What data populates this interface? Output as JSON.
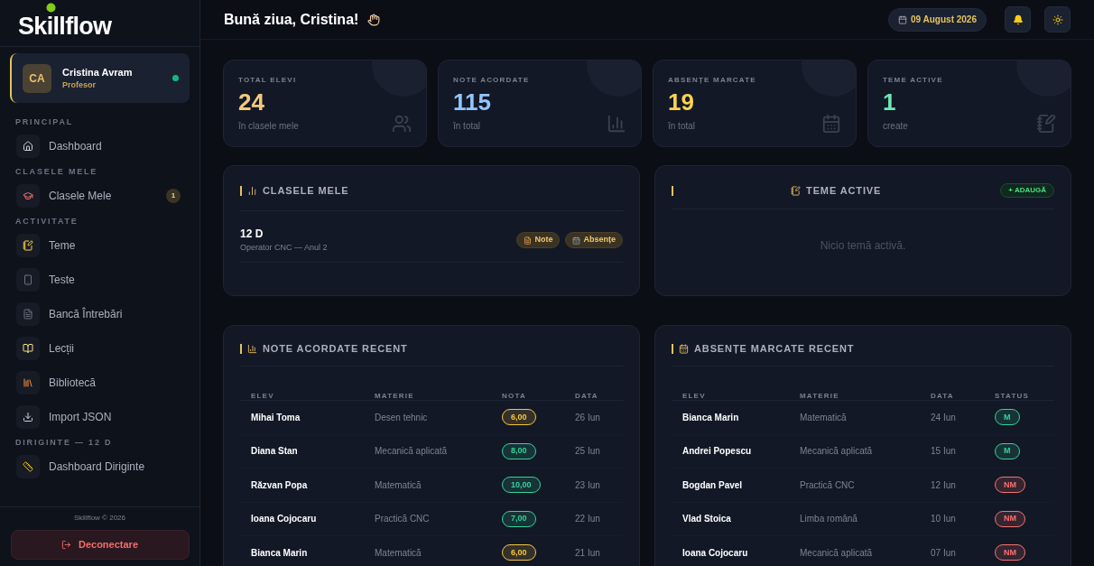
{
  "sidebar": {
    "logo": "Skillflow",
    "user": {
      "initials": "CA",
      "name": "Cristina Avram",
      "role": "Profesor",
      "online": true
    },
    "sections": [
      {
        "title": "PRINCIPAL",
        "items": [
          {
            "label": "Dashboard"
          }
        ]
      },
      {
        "title": "CLASELE MELE",
        "items": [
          {
            "label": "Clasele Mele",
            "badge": "1"
          }
        ]
      },
      {
        "title": "ACTIVITATE",
        "items": [
          {
            "label": "Teme"
          },
          {
            "label": "Teste"
          },
          {
            "label": "Bancă Întrebări"
          },
          {
            "label": "Lecții"
          },
          {
            "label": "Bibliotecă"
          },
          {
            "label": "Import JSON"
          }
        ]
      },
      {
        "title": "DIRIGINTE — 12 D",
        "items": [
          {
            "label": "Dashboard Diriginte"
          }
        ]
      }
    ],
    "footer": "Skillflow © 2026",
    "logout": "Deconectare"
  },
  "header": {
    "greeting": "Bună ziua, Cristina!",
    "date": "09 August 2026"
  },
  "stats": [
    {
      "label": "TOTAL ELEVI",
      "value": "24",
      "sub": "în clasele mele",
      "color": "#f5c97a"
    },
    {
      "label": "NOTE ACORDATE",
      "value": "115",
      "sub": "în total",
      "color": "#93c5fd"
    },
    {
      "label": "ABSENȚE MARCATE",
      "value": "19",
      "sub": "în total",
      "color": "#fcd34d"
    },
    {
      "label": "TEME ACTIVE",
      "value": "1",
      "sub": "create",
      "color": "#6ee7b7"
    }
  ],
  "classes_panel": {
    "title": "CLASELE MELE",
    "classes": [
      {
        "name": "12 D",
        "detail": "Operator CNC — Anul 2",
        "actions": [
          "Note",
          "Absențe"
        ]
      }
    ]
  },
  "homework_panel": {
    "title": "TEME ACTIVE",
    "add": "+ ADAUGĂ",
    "empty": "Nicio temă activă."
  },
  "grades_panel": {
    "title": "NOTE ACORDATE RECENT",
    "columns": [
      "ELEV",
      "MATERIE",
      "NOTA",
      "DATA"
    ],
    "rows": [
      {
        "student": "Mihai Toma",
        "subject": "Desen tehnic",
        "grade": "6,00",
        "color": "#f5c542",
        "date": "26 Iun"
      },
      {
        "student": "Diana Stan",
        "subject": "Mecanică aplicată",
        "grade": "8,00",
        "color": "#34d399",
        "date": "25 Iun"
      },
      {
        "student": "Răzvan Popa",
        "subject": "Matematică",
        "grade": "10,00",
        "color": "#34d399",
        "date": "23 Iun"
      },
      {
        "student": "Ioana Cojocaru",
        "subject": "Practică CNC",
        "grade": "7,00",
        "color": "#34d399",
        "date": "22 Iun"
      },
      {
        "student": "Bianca Marin",
        "subject": "Matematică",
        "grade": "6,00",
        "color": "#f5c542",
        "date": "21 Iun"
      }
    ]
  },
  "absences_panel": {
    "title": "ABSENȚE MARCATE RECENT",
    "columns": [
      "ELEV",
      "MATERIE",
      "DATA",
      "STATUS"
    ],
    "rows": [
      {
        "student": "Bianca Marin",
        "subject": "Matematică",
        "date": "24 Iun",
        "status": "M",
        "color": "#34d399"
      },
      {
        "student": "Andrei Popescu",
        "subject": "Mecanică aplicată",
        "date": "15 Iun",
        "status": "M",
        "color": "#34d399"
      },
      {
        "student": "Bogdan Pavel",
        "subject": "Practică CNC",
        "date": "12 Iun",
        "status": "NM",
        "color": "#f87171"
      },
      {
        "student": "Vlad Stoica",
        "subject": "Limba română",
        "date": "10 Iun",
        "status": "NM",
        "color": "#f87171"
      },
      {
        "student": "Ioana Cojocaru",
        "subject": "Mecanică aplicată",
        "date": "07 Iun",
        "status": "NM",
        "color": "#f87171"
      }
    ]
  }
}
